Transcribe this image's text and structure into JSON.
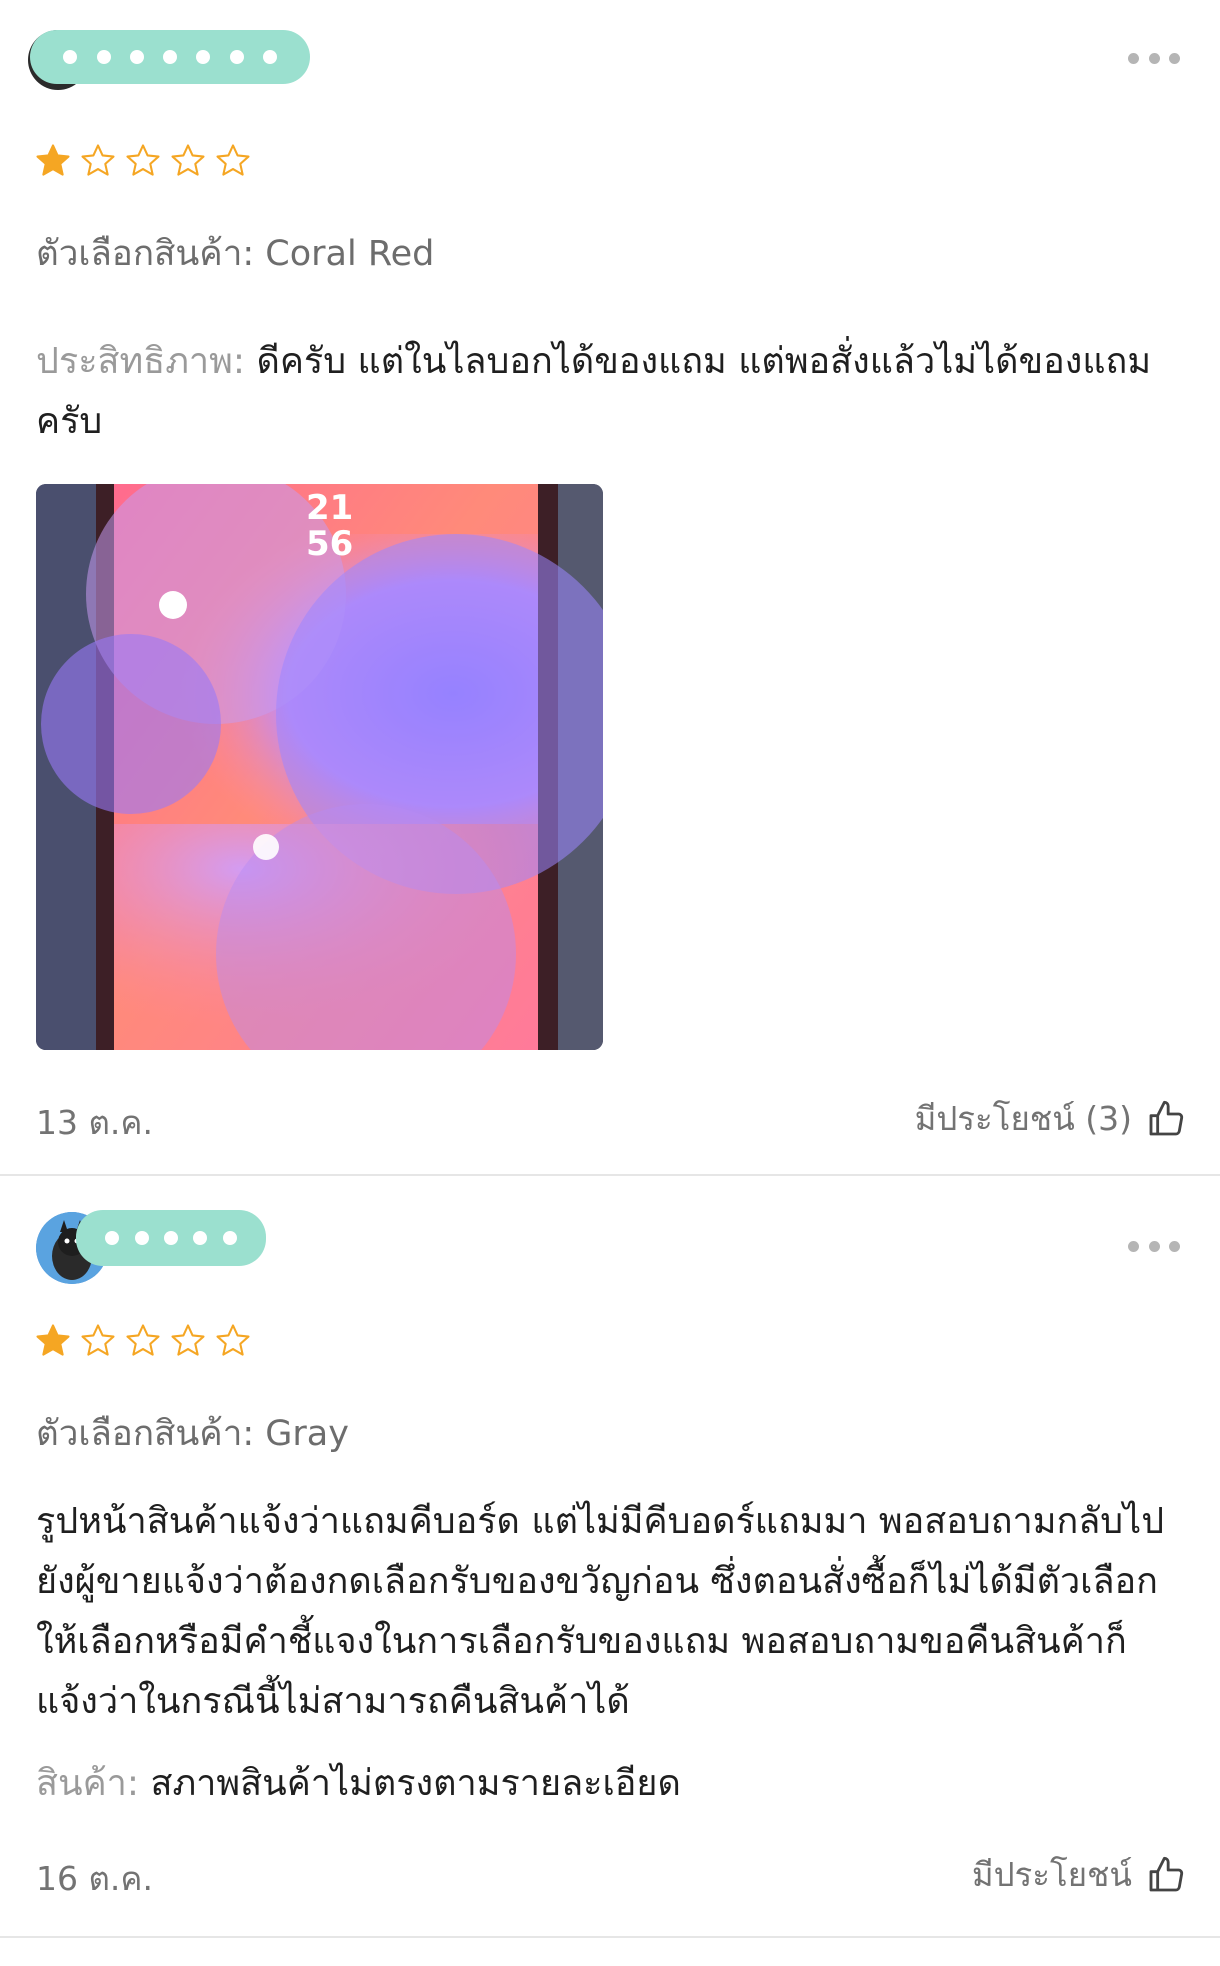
{
  "reviews": [
    {
      "rating": 1,
      "variant_label": "ตัวเลือกสินค้า:",
      "variant_value": "Coral Red",
      "performance_label": "ประสิทธิภาพ:",
      "performance_text": "ดีครับ แต่ในไลบอกได้ของแถม แต่พอสั่งแล้วไม่ได้ของแถมครับ",
      "photo_clock_hour": "21",
      "photo_clock_minute": "56",
      "date": "13 ต.ค.",
      "helpful_label": "มีประโยชน์ (3)"
    },
    {
      "rating": 1,
      "variant_label": "ตัวเลือกสินค้า:",
      "variant_value": "Gray",
      "comment": "รูปหน้าสินค้าแจ้งว่าแถมคีบอร์ด แต่ไม่มีคีบอดร์แถมมา พอสอบถามกลับไปยังผู้ขายแจ้งว่าต้องกดเลือกรับของขวัญก่อน ซึ่งตอนสั่งซื้อก็ไม่ได้มีตัวเลือกให้เลือกหรือมีคำชี้แจงในการเลือกรับของแถม พอสอบถามขอคืนสินค้าก็แจ้งว่าในกรณีนี้ไม่สามารถคืนสินค้าได้",
      "product_label": "สินค้า:",
      "product_text": "สภาพสินค้าไม่ตรงตามรายละเอียด",
      "date": "16 ต.ค.",
      "helpful_label": "มีประโยชน์"
    }
  ],
  "colors": {
    "star_filled": "#f5a623",
    "star_empty": "#f5a623",
    "name_mask": "#9be0cf",
    "divider": "#e6e6e6"
  },
  "icons": [
    "more-options-icon",
    "star-icon",
    "thumbs-up-icon"
  ]
}
